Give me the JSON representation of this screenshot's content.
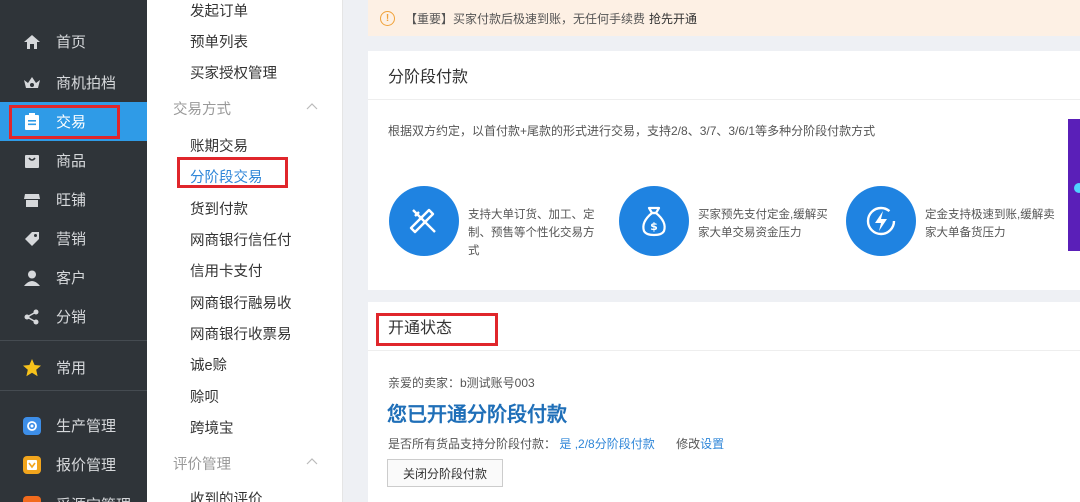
{
  "nav": {
    "items": [
      {
        "label": "首页",
        "icon": "home-icon"
      },
      {
        "label": "商机拍档",
        "icon": "crown-icon"
      },
      {
        "label": "交易",
        "icon": "clipboard-icon"
      },
      {
        "label": "商品",
        "icon": "bag-icon"
      },
      {
        "label": "旺铺",
        "icon": "shop-icon"
      },
      {
        "label": "营销",
        "icon": "tag-icon"
      },
      {
        "label": "客户",
        "icon": "person-icon"
      },
      {
        "label": "分销",
        "icon": "share-icon"
      },
      {
        "label": "常用",
        "icon": "star-icon"
      },
      {
        "label": "生产管理",
        "icon": "factory-icon"
      },
      {
        "label": "报价管理",
        "icon": "quote-icon"
      },
      {
        "label": "采源宝管理",
        "icon": "source-icon"
      }
    ],
    "active_color": "#2f9be7"
  },
  "submenu": {
    "top_items": [
      "发起订单",
      "预单列表",
      "买家授权管理"
    ],
    "group1": "交易方式",
    "group1_items": [
      "账期交易",
      "分阶段交易",
      "货到付款",
      "网商银行信任付",
      "信用卡支付",
      "网商银行融易收",
      "网商银行收票易",
      "诚e赊",
      "赊呗",
      "跨境宝"
    ],
    "group2": "评价管理",
    "group2_items": [
      "收到的评价"
    ]
  },
  "notice": {
    "text": "【重要】买家付款后极速到账，无任何手续费",
    "link": "抢先开通"
  },
  "stage_pay": {
    "title": "分阶段付款",
    "desc": "根据双方约定，以首付款+尾款的形式进行交易，支持2/8、3/7、3/6/1等多种分阶段付款方式",
    "features": [
      {
        "icon": "pencil-ruler-icon",
        "text": "支持大单订货、加工、定制、预售等个性化交易方式"
      },
      {
        "icon": "money-bag-icon",
        "text": "买家预先支付定金,缓解买家大单交易资金压力"
      },
      {
        "icon": "lightning-icon",
        "text": "定金支持极速到账,缓解卖家大单备货压力"
      }
    ]
  },
  "status": {
    "title": "开通状态",
    "greeting": "亲爱的卖家：b测试账号003",
    "headline": "您已开通分阶段付款",
    "support_label": "是否所有货品支持分阶段付款：",
    "support_value": "是 ,2/8分阶段付款",
    "modify": "修改",
    "settings_link": "设置",
    "close_button": "关闭分阶段付款"
  },
  "colors": {
    "highlight": "#e0262b",
    "accent_blue": "#1f83e1"
  }
}
